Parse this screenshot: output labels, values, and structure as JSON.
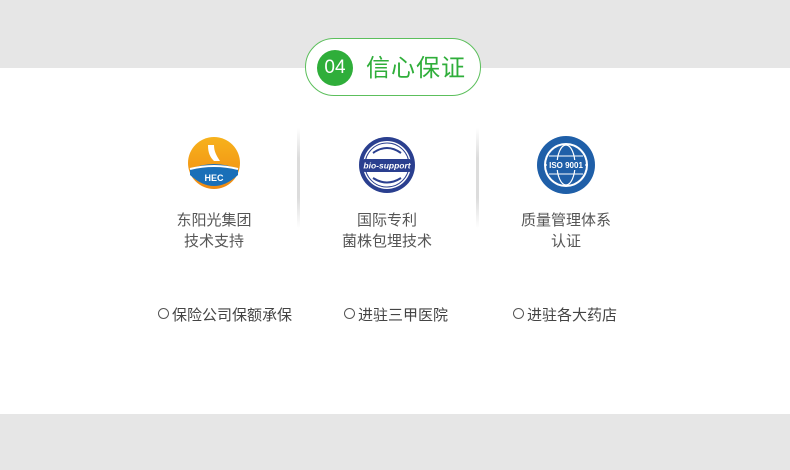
{
  "section": {
    "number": "04",
    "title": "信心保证"
  },
  "features": [
    {
      "icon": "hec-logo",
      "logo_text": "HEC",
      "lines": [
        "东阳光集团",
        "技术支持"
      ]
    },
    {
      "icon": "bio-support-seal",
      "logo_text": "bio-support",
      "lines": [
        "国际专利",
        "菌株包埋技术"
      ]
    },
    {
      "icon": "iso-9001-seal",
      "logo_text": "ISO 9001",
      "lines": [
        "质量管理体系",
        "认证"
      ]
    }
  ],
  "promises": [
    {
      "label": "保险公司保额承保"
    },
    {
      "label": "进驻三甲医院"
    },
    {
      "label": "进驻各大药店"
    }
  ],
  "colors": {
    "accent": "#2fae3a",
    "panel": "#ffffff",
    "band": "#e6e6e6",
    "iso_blue": "#1f5fa8"
  }
}
